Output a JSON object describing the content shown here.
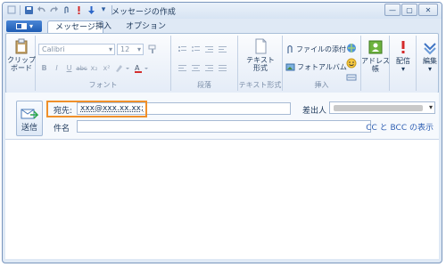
{
  "window": {
    "title": "メッセージの作成",
    "controls": {
      "minimize": "—",
      "maximize": "▢",
      "close": "✕"
    }
  },
  "qat": {
    "dropdown": "▾"
  },
  "tabs": {
    "app_button": "▾",
    "items": [
      {
        "label": "メッセージ",
        "active": true
      },
      {
        "label": "挿入",
        "active": false
      },
      {
        "label": "オプション",
        "active": false
      }
    ]
  },
  "ribbon": {
    "clipboard": {
      "label": "クリップ\nボード",
      "arrow": "▾"
    },
    "font": {
      "family": "Calibri",
      "size": "12",
      "group_label": "フォント",
      "format_buttons": [
        "B",
        "I",
        "U",
        "abc",
        "x₂",
        "x²"
      ]
    },
    "paragraph": {
      "group_label": "段落"
    },
    "text_format": {
      "button": "テキスト\n形式",
      "group_label": "テキスト形式"
    },
    "insert": {
      "attach": "ファイルの添付",
      "photo_album": "フォトアルバム",
      "group_label": "挿入"
    },
    "address_book": "アドレス\n帳",
    "delivery": "配信",
    "edit": "編集"
  },
  "compose": {
    "send": "送信",
    "to_label": "宛先:",
    "to_value": "xxx@xxx.xx.xx;",
    "subject_label": "件名",
    "subject_value": "",
    "from_label": "差出人",
    "cc_bcc": "CC と BCC の表示"
  },
  "colors": {
    "highlight": "#f0902a",
    "accent": "#2f5fb3"
  }
}
